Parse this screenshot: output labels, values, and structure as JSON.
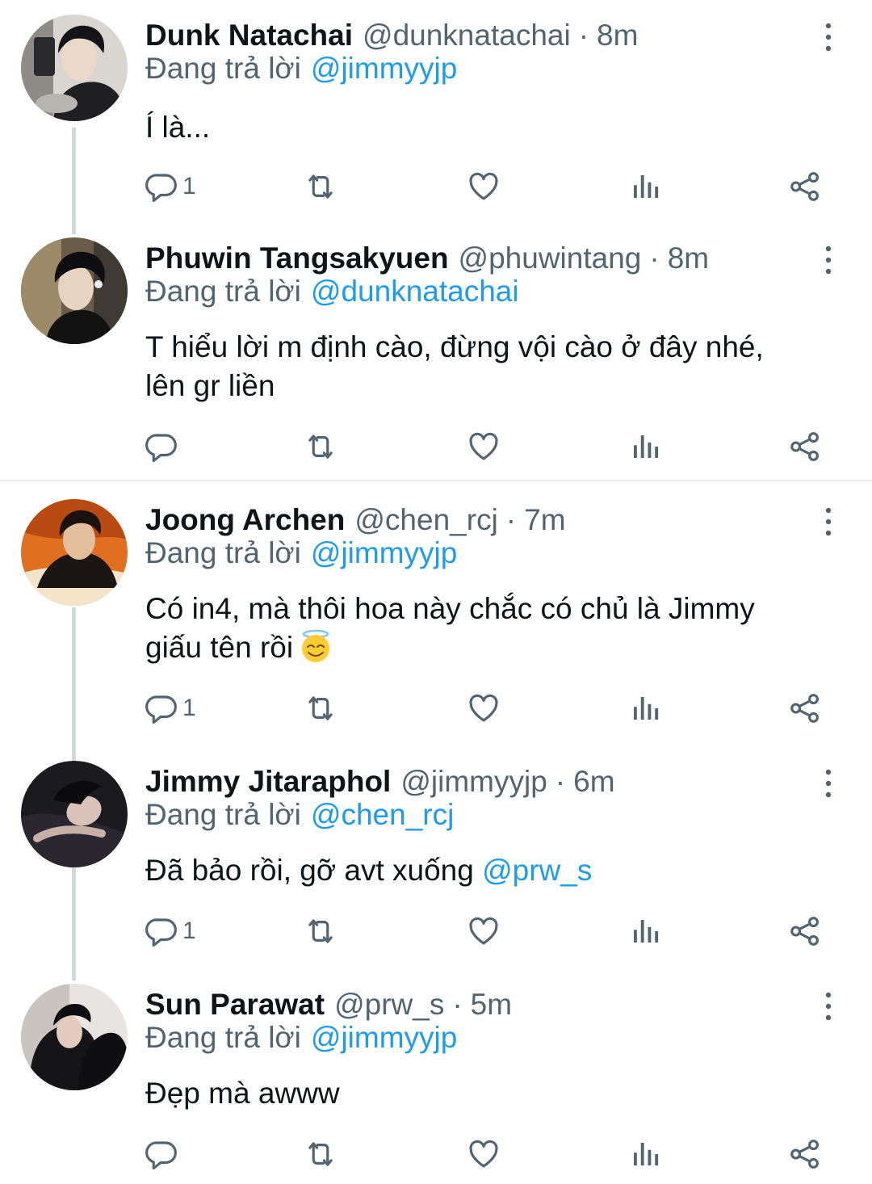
{
  "colors": {
    "link": "#1d9bf0",
    "secondary_text": "#536471",
    "thread_line": "#cfd9de"
  },
  "reply_prefix": "Đang trả lời",
  "tweets": [
    {
      "name": "Dunk Natachai",
      "handle": "@dunknatachai",
      "separator": "·",
      "time": "8m",
      "reply_to": "@jimmyyjp",
      "text": "Í là...",
      "reply_count": "1"
    },
    {
      "name": "Phuwin Tangsakyuen",
      "handle": "@phuwintang",
      "separator": "·",
      "time": "8m",
      "reply_to": "@dunknatachai",
      "text_line1": "T hiểu lời m định cào, đừng vội cào ở đây nhé,",
      "text_line2": "lên gr liền",
      "reply_count": ""
    },
    {
      "name": "Joong Archen",
      "handle": "@chen_rcj",
      "separator": "·",
      "time": "7m",
      "reply_to": "@jimmyyjp",
      "text_line1": "Có in4, mà thôi hoa này chắc có chủ là Jimmy",
      "text_line2": "giấu tên rồi",
      "emoji": "smiling-face-with-halo",
      "reply_count": "1"
    },
    {
      "name": "Jimmy Jitaraphol",
      "handle": "@jimmyyjp",
      "separator": "·",
      "time": "6m",
      "reply_to": "@chen_rcj",
      "text": "Đã bảo rồi, gỡ avt xuống",
      "text_mention": "@prw_s",
      "reply_count": "1"
    },
    {
      "name": "Sun Parawat",
      "handle": "@prw_s",
      "separator": "·",
      "time": "5m",
      "reply_to": "@jimmyyjp",
      "text": "Đẹp mà awww",
      "reply_count": ""
    }
  ]
}
